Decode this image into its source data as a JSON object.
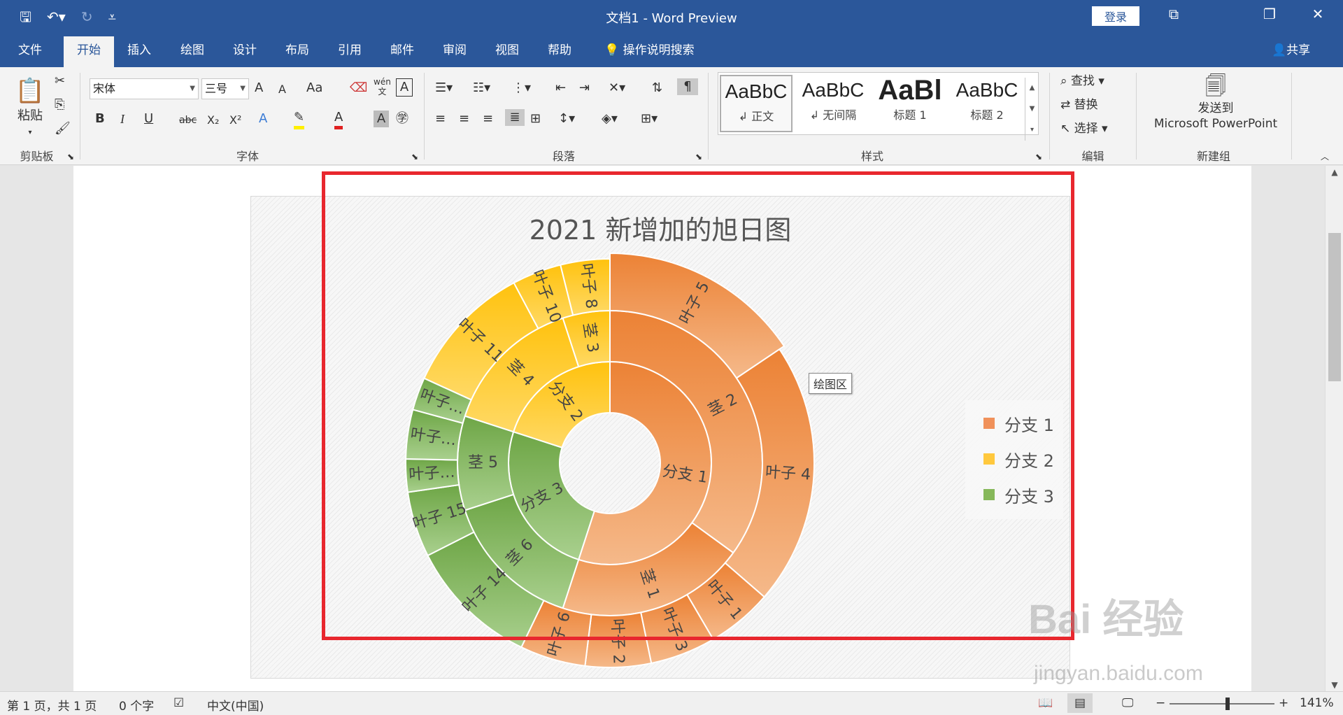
{
  "titlebar": {
    "doc_title": "文档1  -  Word Preview",
    "login_label": "登录",
    "qat_icons": [
      "save-icon",
      "undo-icon",
      "redo-icon",
      "customize-icon"
    ],
    "window_buttons": [
      "ribbon-display-icon",
      "restore-icon",
      "close-icon"
    ]
  },
  "tabs": {
    "items": [
      "文件",
      "开始",
      "插入",
      "绘图",
      "设计",
      "布局",
      "引用",
      "邮件",
      "审阅",
      "视图",
      "帮助"
    ],
    "active": "开始",
    "tell_me": "操作说明搜索",
    "share": "共享"
  },
  "ribbon": {
    "clipboard": {
      "paste_label": "粘贴",
      "group_label": "剪贴板"
    },
    "font": {
      "font_name": "宋体",
      "font_size": "三号",
      "buttons": [
        "A",
        "A",
        "Aa",
        "B",
        "I",
        "U",
        "abc",
        "X₂",
        "X²",
        "A",
        "A",
        "A"
      ],
      "wen_label": "wén",
      "group_label": "字体"
    },
    "paragraph": {
      "group_label": "段落"
    },
    "styles": {
      "items": [
        {
          "sample": "AaBbC",
          "name": "↲ 正文"
        },
        {
          "sample": "AaBbC",
          "name": "↲ 无间隔"
        },
        {
          "sample": "AaBl",
          "name": "标题 1"
        },
        {
          "sample": "AaBbC",
          "name": "标题 2"
        }
      ],
      "group_label": "样式"
    },
    "editing": {
      "find": "查找",
      "replace": "替换",
      "select": "选择",
      "group_label": "编辑"
    },
    "newgroup": {
      "send_line1": "发送到",
      "send_line2": "Microsoft PowerPoint",
      "group_label": "新建组"
    }
  },
  "chart_data": {
    "type": "sunburst",
    "title": "2021 新增加的旭日图",
    "legend": [
      "分支 1",
      "分支 2",
      "分支 3"
    ],
    "legend_position": "right",
    "colors": {
      "分支 1": "#f0915a",
      "分支 2": "#ffc83d",
      "分支 3": "#86b85a"
    },
    "rings": [
      [
        {
          "label": "分支 1",
          "value": 22,
          "branch": 0
        },
        {
          "label": "分支 3",
          "value": 10,
          "branch": 2
        },
        {
          "label": "分支 2",
          "value": 8,
          "branch": 1
        }
      ],
      [
        {
          "label": "茎 2",
          "value": 14,
          "branch": 0
        },
        {
          "label": "茎 1",
          "value": 8,
          "branch": 0
        },
        {
          "label": "茎 6",
          "value": 6,
          "branch": 2
        },
        {
          "label": "茎 5",
          "value": 4,
          "branch": 2
        },
        {
          "label": "茎 4",
          "value": 6,
          "branch": 1
        },
        {
          "label": "茎 3",
          "value": 2,
          "branch": 1
        }
      ],
      [
        {
          "label": "叶子 5",
          "value": 6,
          "branch": 0
        },
        {
          "label": "叶子 4",
          "value": 8,
          "branch": 0
        },
        {
          "label": "叶子 1",
          "value": 2,
          "branch": 0
        },
        {
          "label": "叶子 3",
          "value": 2,
          "branch": 0
        },
        {
          "label": "叶子 2",
          "value": 2,
          "branch": 0
        },
        {
          "label": "叶子 6",
          "value": 2,
          "branch": 0
        },
        {
          "label": "叶子 14",
          "value": 4,
          "branch": 2
        },
        {
          "label": "叶子 15",
          "value": 2,
          "branch": 2
        },
        {
          "label": "叶子…",
          "value": 1,
          "branch": 2
        },
        {
          "label": "叶子…",
          "value": 1.5,
          "branch": 2
        },
        {
          "label": "叶子…",
          "value": 1,
          "branch": 2
        },
        {
          "label": "叶子 11",
          "value": 4,
          "branch": 1
        },
        {
          "label": "叶子 10",
          "value": 1.5,
          "branch": 1
        },
        {
          "label": "叶子 8",
          "value": 1.5,
          "branch": 1
        }
      ]
    ]
  },
  "tooltip": "绘图区",
  "watermark": {
    "main": "Bai 经验",
    "sub": "jingyan.baidu.com"
  },
  "statusbar": {
    "page": "第 1 页，共 1 页",
    "words": "0 个字",
    "language": "中文(中国)",
    "zoom": "141%"
  }
}
